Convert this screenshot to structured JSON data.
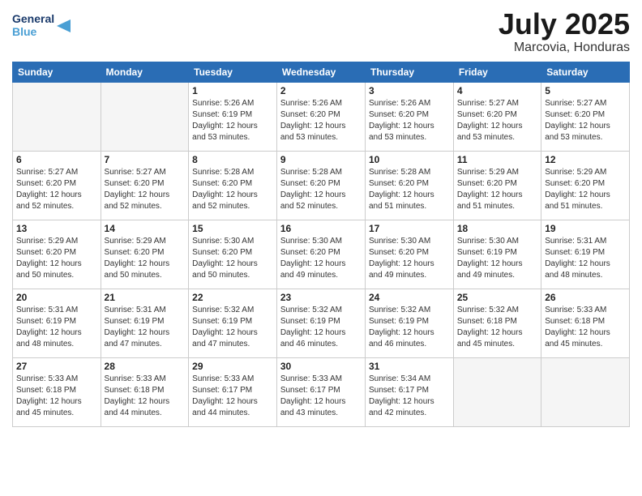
{
  "logo": {
    "line1": "General",
    "line2": "Blue"
  },
  "title": "July 2025",
  "location": "Marcovia, Honduras",
  "days_header": [
    "Sunday",
    "Monday",
    "Tuesday",
    "Wednesday",
    "Thursday",
    "Friday",
    "Saturday"
  ],
  "weeks": [
    [
      {
        "day": "",
        "info": ""
      },
      {
        "day": "",
        "info": ""
      },
      {
        "day": "1",
        "info": "Sunrise: 5:26 AM\nSunset: 6:19 PM\nDaylight: 12 hours\nand 53 minutes."
      },
      {
        "day": "2",
        "info": "Sunrise: 5:26 AM\nSunset: 6:20 PM\nDaylight: 12 hours\nand 53 minutes."
      },
      {
        "day": "3",
        "info": "Sunrise: 5:26 AM\nSunset: 6:20 PM\nDaylight: 12 hours\nand 53 minutes."
      },
      {
        "day": "4",
        "info": "Sunrise: 5:27 AM\nSunset: 6:20 PM\nDaylight: 12 hours\nand 53 minutes."
      },
      {
        "day": "5",
        "info": "Sunrise: 5:27 AM\nSunset: 6:20 PM\nDaylight: 12 hours\nand 53 minutes."
      }
    ],
    [
      {
        "day": "6",
        "info": "Sunrise: 5:27 AM\nSunset: 6:20 PM\nDaylight: 12 hours\nand 52 minutes."
      },
      {
        "day": "7",
        "info": "Sunrise: 5:27 AM\nSunset: 6:20 PM\nDaylight: 12 hours\nand 52 minutes."
      },
      {
        "day": "8",
        "info": "Sunrise: 5:28 AM\nSunset: 6:20 PM\nDaylight: 12 hours\nand 52 minutes."
      },
      {
        "day": "9",
        "info": "Sunrise: 5:28 AM\nSunset: 6:20 PM\nDaylight: 12 hours\nand 52 minutes."
      },
      {
        "day": "10",
        "info": "Sunrise: 5:28 AM\nSunset: 6:20 PM\nDaylight: 12 hours\nand 51 minutes."
      },
      {
        "day": "11",
        "info": "Sunrise: 5:29 AM\nSunset: 6:20 PM\nDaylight: 12 hours\nand 51 minutes."
      },
      {
        "day": "12",
        "info": "Sunrise: 5:29 AM\nSunset: 6:20 PM\nDaylight: 12 hours\nand 51 minutes."
      }
    ],
    [
      {
        "day": "13",
        "info": "Sunrise: 5:29 AM\nSunset: 6:20 PM\nDaylight: 12 hours\nand 50 minutes."
      },
      {
        "day": "14",
        "info": "Sunrise: 5:29 AM\nSunset: 6:20 PM\nDaylight: 12 hours\nand 50 minutes."
      },
      {
        "day": "15",
        "info": "Sunrise: 5:30 AM\nSunset: 6:20 PM\nDaylight: 12 hours\nand 50 minutes."
      },
      {
        "day": "16",
        "info": "Sunrise: 5:30 AM\nSunset: 6:20 PM\nDaylight: 12 hours\nand 49 minutes."
      },
      {
        "day": "17",
        "info": "Sunrise: 5:30 AM\nSunset: 6:20 PM\nDaylight: 12 hours\nand 49 minutes."
      },
      {
        "day": "18",
        "info": "Sunrise: 5:30 AM\nSunset: 6:19 PM\nDaylight: 12 hours\nand 49 minutes."
      },
      {
        "day": "19",
        "info": "Sunrise: 5:31 AM\nSunset: 6:19 PM\nDaylight: 12 hours\nand 48 minutes."
      }
    ],
    [
      {
        "day": "20",
        "info": "Sunrise: 5:31 AM\nSunset: 6:19 PM\nDaylight: 12 hours\nand 48 minutes."
      },
      {
        "day": "21",
        "info": "Sunrise: 5:31 AM\nSunset: 6:19 PM\nDaylight: 12 hours\nand 47 minutes."
      },
      {
        "day": "22",
        "info": "Sunrise: 5:32 AM\nSunset: 6:19 PM\nDaylight: 12 hours\nand 47 minutes."
      },
      {
        "day": "23",
        "info": "Sunrise: 5:32 AM\nSunset: 6:19 PM\nDaylight: 12 hours\nand 46 minutes."
      },
      {
        "day": "24",
        "info": "Sunrise: 5:32 AM\nSunset: 6:19 PM\nDaylight: 12 hours\nand 46 minutes."
      },
      {
        "day": "25",
        "info": "Sunrise: 5:32 AM\nSunset: 6:18 PM\nDaylight: 12 hours\nand 45 minutes."
      },
      {
        "day": "26",
        "info": "Sunrise: 5:33 AM\nSunset: 6:18 PM\nDaylight: 12 hours\nand 45 minutes."
      }
    ],
    [
      {
        "day": "27",
        "info": "Sunrise: 5:33 AM\nSunset: 6:18 PM\nDaylight: 12 hours\nand 45 minutes."
      },
      {
        "day": "28",
        "info": "Sunrise: 5:33 AM\nSunset: 6:18 PM\nDaylight: 12 hours\nand 44 minutes."
      },
      {
        "day": "29",
        "info": "Sunrise: 5:33 AM\nSunset: 6:17 PM\nDaylight: 12 hours\nand 44 minutes."
      },
      {
        "day": "30",
        "info": "Sunrise: 5:33 AM\nSunset: 6:17 PM\nDaylight: 12 hours\nand 43 minutes."
      },
      {
        "day": "31",
        "info": "Sunrise: 5:34 AM\nSunset: 6:17 PM\nDaylight: 12 hours\nand 42 minutes."
      },
      {
        "day": "",
        "info": ""
      },
      {
        "day": "",
        "info": ""
      }
    ]
  ]
}
